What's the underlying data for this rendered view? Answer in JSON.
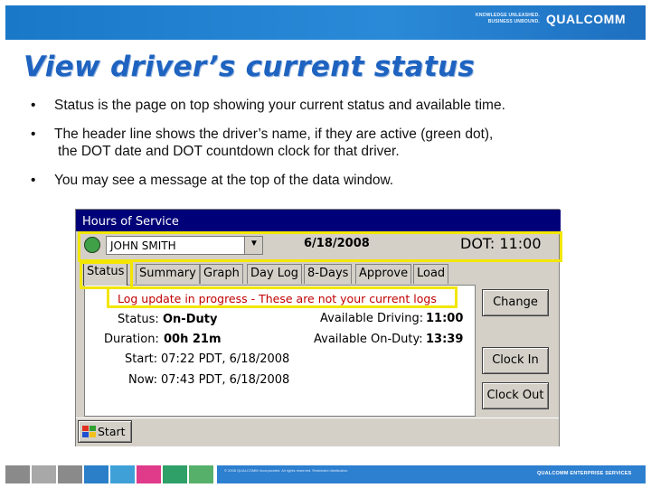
{
  "banner": {
    "tagline": "KNOWLEDGE UNLEASHED. BUSINESS UNBOUND.",
    "brand": "QUALCOMM"
  },
  "slide": {
    "title": "View driver’s current status",
    "bullets": [
      {
        "line1": "Status is the page on top showing your current status and available time.",
        "line2": ""
      },
      {
        "line1": "The header line shows the driver’s name, if they are active (green dot),",
        "line2": "the DOT date and DOT countdown clock for that driver."
      },
      {
        "line1": "You may see a message at the top of the data window.",
        "line2": ""
      }
    ],
    "bullet_symbol": "•"
  },
  "device": {
    "window_title": "Hours of Service",
    "driver_name": "JOHN SMITH",
    "dot_date": "6/18/2008",
    "dot_clock": "DOT: 11:00",
    "tabs": [
      "Status",
      "Summary",
      "Graph",
      "Day Log",
      "8-Days",
      "Approve",
      "Load"
    ],
    "message": "Log update in progress - These are not your current logs",
    "status_label": "Status:",
    "status_value": "On-Duty",
    "duration_label": "Duration:",
    "duration_value": "00h 21m",
    "start_label": "Start:",
    "start_value": "07:22 PDT, 6/18/2008",
    "now_label": "Now:",
    "now_value": "07:43 PDT, 6/18/2008",
    "avail_driving_label": "Available Driving:",
    "avail_driving_value": "11:00",
    "avail_onduty_label": "Available On-Duty:",
    "avail_onduty_value": "13:39",
    "buttons": {
      "change": "Change",
      "clock_in": "Clock In",
      "clock_out": "Clock Out"
    },
    "start_button": "Start",
    "active_status_color": "#3fa048"
  },
  "footer": {
    "copyright": "© 2008 QUALCOMM Incorporated. All rights reserved. Restricted distribution.",
    "brand": "QUALCOMM ENTERPRISE SERVICES",
    "colors": [
      "#8a8a8a",
      "#a8a8a8",
      "#2a7fc8",
      "#3fa0d8",
      "#e03a8a",
      "#2ea068",
      "#56b06a",
      "#8a8a8a"
    ]
  }
}
